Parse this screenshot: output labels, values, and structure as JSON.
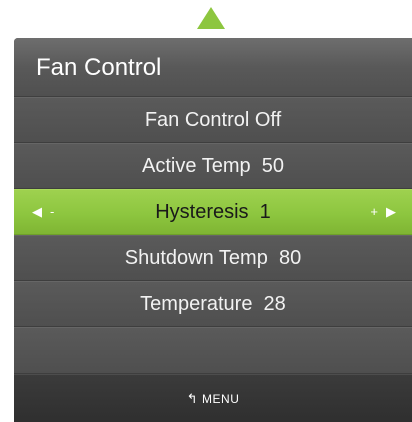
{
  "menu": {
    "title": "Fan Control",
    "items": [
      {
        "label": "Fan Control Off"
      },
      {
        "label": "Active Temp  50"
      },
      {
        "label": "Hysteresis  1",
        "decrease": "-",
        "increase": "+"
      },
      {
        "label": "Shutdown Temp  80"
      },
      {
        "label": "Temperature  28"
      }
    ],
    "footer": {
      "label": "MENU",
      "icon": "return-arrow-icon"
    }
  },
  "colors": {
    "accent": "#8dc63f",
    "panel": "#4d4d4d",
    "text": "#ffffff"
  }
}
